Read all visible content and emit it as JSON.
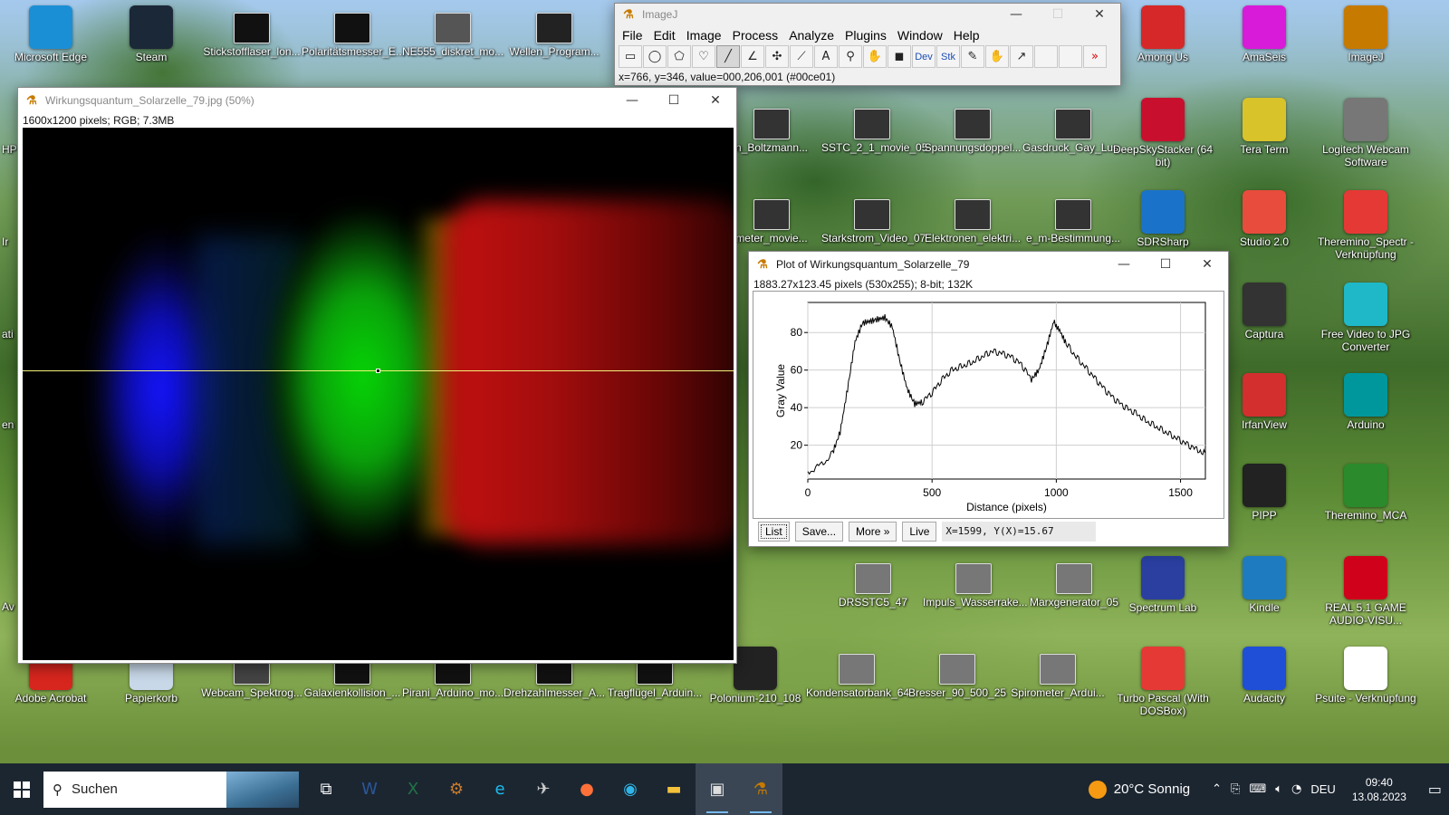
{
  "desktop": {
    "icons_left": [
      {
        "label": "Microsoft Edge",
        "icon": "edge-icon",
        "color": "#1b8fd6"
      },
      {
        "label": "Steam",
        "icon": "steam-icon",
        "color": "#1b2838"
      },
      {
        "label": "Stickstofflaser_lon...",
        "icon": "video-thumbnail-icon",
        "color": "#111111"
      },
      {
        "label": "Polaritätsmesser_E...",
        "icon": "video-thumbnail-icon",
        "color": "#111111"
      },
      {
        "label": "NE555_diskret_mo...",
        "icon": "photo-thumbnail-icon",
        "color": "#555555"
      },
      {
        "label": "Wellen_Program...",
        "icon": "video-thumbnail-icon",
        "color": "#222222"
      }
    ],
    "icons_mid_row1": [
      {
        "label": "n_Boltzmann...",
        "icon": "photo-thumbnail-icon"
      },
      {
        "label": "SSTC_2_1_movie_05",
        "icon": "video-thumbnail-icon"
      },
      {
        "label": "Spannungsdoppel...",
        "icon": "video-thumbnail-icon"
      },
      {
        "label": "Gasdruck_Gay_Lus...",
        "icon": "video-thumbnail-icon"
      }
    ],
    "icons_mid_row2": [
      {
        "label": "meter_movie...",
        "icon": "photo-thumbnail-icon"
      },
      {
        "label": "Starkstrom_Video_07",
        "icon": "video-thumbnail-icon"
      },
      {
        "label": "Elektronen_elektri...",
        "icon": "video-thumbnail-icon"
      },
      {
        "label": "e_m-Bestimmung...",
        "icon": "photo-thumbnail-icon"
      }
    ],
    "icons_right_col1": [
      {
        "label": "Among Us",
        "icon": "among-us-icon",
        "color": "#d62828"
      },
      {
        "label": "DeepSkyStacker (64 bit)",
        "icon": "deepskystacker-icon",
        "color": "#c8102e"
      },
      {
        "label": "SDRSharp",
        "icon": "sdrsharp-icon",
        "color": "#1a73c9"
      },
      {
        "label": "",
        "icon": "",
        "color": ""
      },
      {
        "label": "",
        "icon": "",
        "color": ""
      },
      {
        "label": "",
        "icon": "",
        "color": ""
      },
      {
        "label": "Spectrum Lab",
        "icon": "spectrum-lab-icon",
        "color": "#2a3fa0"
      },
      {
        "label": "Turbo Pascal (With DOSBox)",
        "icon": "turbo-pascal-icon",
        "color": "#e53935"
      }
    ],
    "icons_right_col2": [
      {
        "label": "AmaSeis",
        "icon": "amaseis-icon",
        "color": "#d81bd8"
      },
      {
        "label": "Tera Term",
        "icon": "tera-term-icon",
        "color": "#d8c32a"
      },
      {
        "label": "Studio 2.0",
        "icon": "studio-icon",
        "color": "#e74c3c"
      },
      {
        "label": "Captura",
        "icon": "captura-icon",
        "color": "#333333"
      },
      {
        "label": "IrfanView",
        "icon": "irfanview-icon",
        "color": "#d32f2f"
      },
      {
        "label": "PIPP",
        "icon": "pipp-icon",
        "color": "#222222"
      },
      {
        "label": "Kindle",
        "icon": "kindle-icon",
        "color": "#1e7bbf"
      },
      {
        "label": "Audacity",
        "icon": "audacity-icon",
        "color": "#1e4fd6"
      }
    ],
    "icons_right_col3": [
      {
        "label": "ImageJ",
        "icon": "imagej-icon",
        "color": "#c77a00"
      },
      {
        "label": "Logitech Webcam Software",
        "icon": "webcam-icon",
        "color": "#777777"
      },
      {
        "label": "Theremino_Spectr - Verknüpfung",
        "icon": "theremino-icon",
        "color": "#e53935"
      },
      {
        "label": "Free Video to JPG Converter",
        "icon": "jpg-converter-icon",
        "color": "#1fb8c8"
      },
      {
        "label": "Arduino",
        "icon": "arduino-icon",
        "color": "#00979c"
      },
      {
        "label": "Theremino_MCA",
        "icon": "theremino-mca-icon",
        "color": "#2b8a2b"
      },
      {
        "label": "REAL 5.1 GAME AUDIO-VISU...",
        "icon": "real-game-icon",
        "color": "#d0021b"
      },
      {
        "label": "Psuite - Verknüpfung",
        "icon": "psuite-icon",
        "color": "#ffffff"
      }
    ],
    "icons_mid_row3": [
      {
        "label": "DRSSTC5_47",
        "icon": "photo-thumbnail-icon"
      },
      {
        "label": "Impuls_Wasserrake...",
        "icon": "photo-thumbnail-icon"
      },
      {
        "label": "Marxgenerator_05",
        "icon": "photo-thumbnail-icon"
      }
    ],
    "icons_bottom": [
      {
        "label": "Adobe Acrobat",
        "icon": "acrobat-icon",
        "color": "#d7261e"
      },
      {
        "label": "Papierkorb",
        "icon": "recycle-bin-icon",
        "color": "#c8d8e8"
      },
      {
        "label": "Webcam_Spektrog...",
        "icon": "photo-thumbnail-icon",
        "color": "#444444"
      },
      {
        "label": "Galaxienkollision_...",
        "icon": "video-thumbnail-icon",
        "color": "#111111"
      },
      {
        "label": "Pirani_Arduino_mo...",
        "icon": "video-thumbnail-icon",
        "color": "#111111"
      },
      {
        "label": "Drehzahlmesser_A...",
        "icon": "video-thumbnail-icon",
        "color": "#111111"
      },
      {
        "label": "Tragflügel_Arduin...",
        "icon": "video-thumbnail-icon",
        "color": "#111111"
      },
      {
        "label": "Polonium-210_108",
        "icon": "radiation-icon",
        "color": "#222222"
      },
      {
        "label": "Kondensatorbank_64",
        "icon": "photo-thumbnail-icon",
        "color": "#777777"
      },
      {
        "label": "Bresser_90_500_25",
        "icon": "photo-thumbnail-icon",
        "color": "#777777"
      },
      {
        "label": "Spirometer_Ardui...",
        "icon": "photo-thumbnail-icon",
        "color": "#777777"
      }
    ],
    "partial_left_labels": [
      "HP",
      "Ir",
      "Av",
      "ati",
      "en"
    ]
  },
  "imagej": {
    "title": "ImageJ",
    "menus": [
      "File",
      "Edit",
      "Image",
      "Process",
      "Analyze",
      "Plugins",
      "Window",
      "Help"
    ],
    "tools": [
      {
        "name": "rectangle-tool",
        "glyph": "▭"
      },
      {
        "name": "oval-tool",
        "glyph": "◯"
      },
      {
        "name": "polygon-tool",
        "glyph": "⬠"
      },
      {
        "name": "freehand-tool",
        "glyph": "♡"
      },
      {
        "name": "line-tool",
        "glyph": "╱",
        "selected": true
      },
      {
        "name": "angle-tool",
        "glyph": "∠"
      },
      {
        "name": "point-tool",
        "glyph": "✣"
      },
      {
        "name": "wand-tool",
        "glyph": "⟋"
      },
      {
        "name": "text-tool",
        "glyph": "A"
      },
      {
        "name": "magnifier-tool",
        "glyph": "⚲"
      },
      {
        "name": "hand-tool",
        "glyph": "✋"
      },
      {
        "name": "color-picker-tool",
        "glyph": "◼"
      },
      {
        "name": "dev-tool",
        "glyph": "Dev"
      },
      {
        "name": "stk-tool",
        "glyph": "Stk"
      },
      {
        "name": "brush-tool",
        "glyph": "✎"
      },
      {
        "name": "flood-tool",
        "glyph": "✋"
      },
      {
        "name": "arrow-tool",
        "glyph": "↗"
      },
      {
        "name": "empty-tool-1",
        "glyph": ""
      },
      {
        "name": "empty-tool-2",
        "glyph": ""
      },
      {
        "name": "more-tools",
        "glyph": "»"
      }
    ],
    "status": "x=766, y=346, value=000,206,001 (#00ce01)"
  },
  "image_window": {
    "title": "Wirkungsquantum_Solarzelle_79.jpg (50%)",
    "info": "1600x1200 pixels; RGB; 7.3MB"
  },
  "plot_window": {
    "title": "Plot of Wirkungsquantum_Solarzelle_79",
    "info": "1883.27x123.45 pixels (530x255); 8-bit; 132K",
    "buttons": {
      "list": "List",
      "save": "Save...",
      "more": "More »",
      "live": "Live"
    },
    "readout": "X=1599, Y(X)=15.67"
  },
  "chart_data": {
    "type": "line",
    "xlabel": "Distance (pixels)",
    "ylabel": "Gray Value",
    "xlim": [
      0,
      1600
    ],
    "ylim": [
      2,
      96
    ],
    "xticks": [
      0,
      500,
      1000,
      1500
    ],
    "yticks": [
      20,
      40,
      60,
      80
    ],
    "grid": true,
    "series": [
      {
        "color": "#000000",
        "x": [
          0,
          50,
          100,
          130,
          160,
          190,
          220,
          250,
          280,
          310,
          340,
          370,
          400,
          430,
          460,
          500,
          540,
          580,
          620,
          660,
          700,
          740,
          780,
          820,
          860,
          900,
          930,
          960,
          990,
          1010,
          1040,
          1080,
          1120,
          1160,
          1200,
          1240,
          1280,
          1320,
          1360,
          1400,
          1440,
          1480,
          1520,
          1560,
          1599
        ],
        "y": [
          6,
          9,
          16,
          27,
          50,
          75,
          85,
          86,
          87,
          88,
          83,
          65,
          50,
          42,
          43,
          48,
          55,
          60,
          62,
          64,
          67,
          70,
          69,
          67,
          63,
          55,
          60,
          72,
          86,
          82,
          74,
          67,
          61,
          55,
          49,
          44,
          40,
          37,
          33,
          30,
          27,
          24,
          21,
          18,
          16
        ]
      }
    ]
  },
  "taskbar": {
    "search_placeholder": "Suchen",
    "weather": "20°C  Sonnig",
    "lang": "DEU",
    "time": "09:40",
    "date": "13.08.2023",
    "apps": [
      {
        "name": "task-view-icon",
        "glyph": "⧉"
      },
      {
        "name": "word-icon",
        "glyph": "W",
        "color": "#2b579a"
      },
      {
        "name": "excel-icon",
        "glyph": "X",
        "color": "#217346"
      },
      {
        "name": "app-tool-icon",
        "glyph": "⚙",
        "color": "#c97b2a"
      },
      {
        "name": "internet-explorer-icon",
        "glyph": "e",
        "color": "#1ebbee"
      },
      {
        "name": "app-drone-icon",
        "glyph": "✈",
        "color": "#cccccc"
      },
      {
        "name": "firefox-icon",
        "glyph": "●",
        "color": "#ff7139"
      },
      {
        "name": "edge-taskbar-icon",
        "glyph": "◉",
        "color": "#2fb5e8"
      },
      {
        "name": "file-explorer-icon",
        "glyph": "▬",
        "color": "#f3c13a"
      },
      {
        "name": "imagej-viewer-icon",
        "glyph": "▣",
        "color": "#dddddd",
        "active": true
      },
      {
        "name": "imagej-taskbar-icon",
        "glyph": "⚗",
        "color": "#c77a00",
        "active": true
      }
    ]
  }
}
